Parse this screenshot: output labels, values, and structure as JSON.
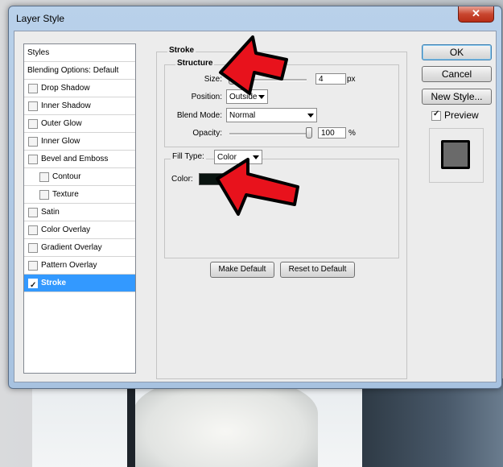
{
  "window": {
    "title": "Layer Style",
    "close_glyph": "✕"
  },
  "styles_panel": {
    "header": "Styles",
    "blending": "Blending Options: Default",
    "items": [
      {
        "label": "Drop Shadow",
        "checked": false
      },
      {
        "label": "Inner Shadow",
        "checked": false
      },
      {
        "label": "Outer Glow",
        "checked": false
      },
      {
        "label": "Inner Glow",
        "checked": false
      },
      {
        "label": "Bevel and Emboss",
        "checked": false
      },
      {
        "label": "Contour",
        "checked": false
      },
      {
        "label": "Texture",
        "checked": false
      },
      {
        "label": "Satin",
        "checked": false
      },
      {
        "label": "Color Overlay",
        "checked": false
      },
      {
        "label": "Gradient Overlay",
        "checked": false
      },
      {
        "label": "Pattern Overlay",
        "checked": false
      },
      {
        "label": "Stroke",
        "checked": true,
        "selected": true
      }
    ]
  },
  "stroke": {
    "group_title": "Stroke",
    "structure_title": "Structure",
    "size_label": "Size:",
    "size_value": "4",
    "size_unit": "px",
    "position_label": "Position:",
    "position_value": "Outside",
    "blend_label": "Blend Mode:",
    "blend_value": "Normal",
    "opacity_label": "Opacity:",
    "opacity_value": "100",
    "opacity_unit": "%",
    "fill_type_label": "Fill Type:",
    "fill_type_value": "Color",
    "color_label": "Color:",
    "color_hex": "#0a1410",
    "make_default": "Make Default",
    "reset_default": "Reset to Default"
  },
  "actions": {
    "ok": "OK",
    "cancel": "Cancel",
    "new_style": "New Style...",
    "preview_label": "Preview",
    "preview_checked": true
  },
  "colors": {
    "selection": "#3399ff",
    "arrow_red": "#e8121c"
  }
}
